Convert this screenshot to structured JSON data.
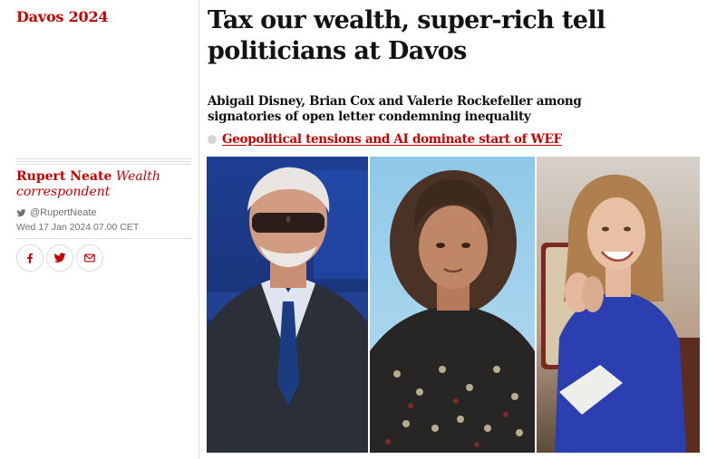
{
  "section": {
    "label": "Davos 2024"
  },
  "byline": {
    "author": "Rupert Neate",
    "role": "Wealth correspondent",
    "twitter_handle": "@RupertNeate",
    "date": "Wed 17 Jan 2024 07.00 CET"
  },
  "share": [
    {
      "icon": "facebook-icon",
      "label": "f"
    },
    {
      "icon": "twitter-icon",
      "label": "twitter"
    },
    {
      "icon": "email-icon",
      "label": "email"
    }
  ],
  "article": {
    "headline": "Tax our wealth, super-rich tell politicians at Davos",
    "standfirst": "Abigail Disney, Brian Cox and Valerie Rockefeller among signatories of open letter condemning inequality",
    "related_link": "Geopolitical tensions and AI dominate start of WEF"
  },
  "colors": {
    "accent": "#c70000",
    "text": "#121212",
    "meta": "#707070",
    "rule": "#dcdcdc"
  }
}
